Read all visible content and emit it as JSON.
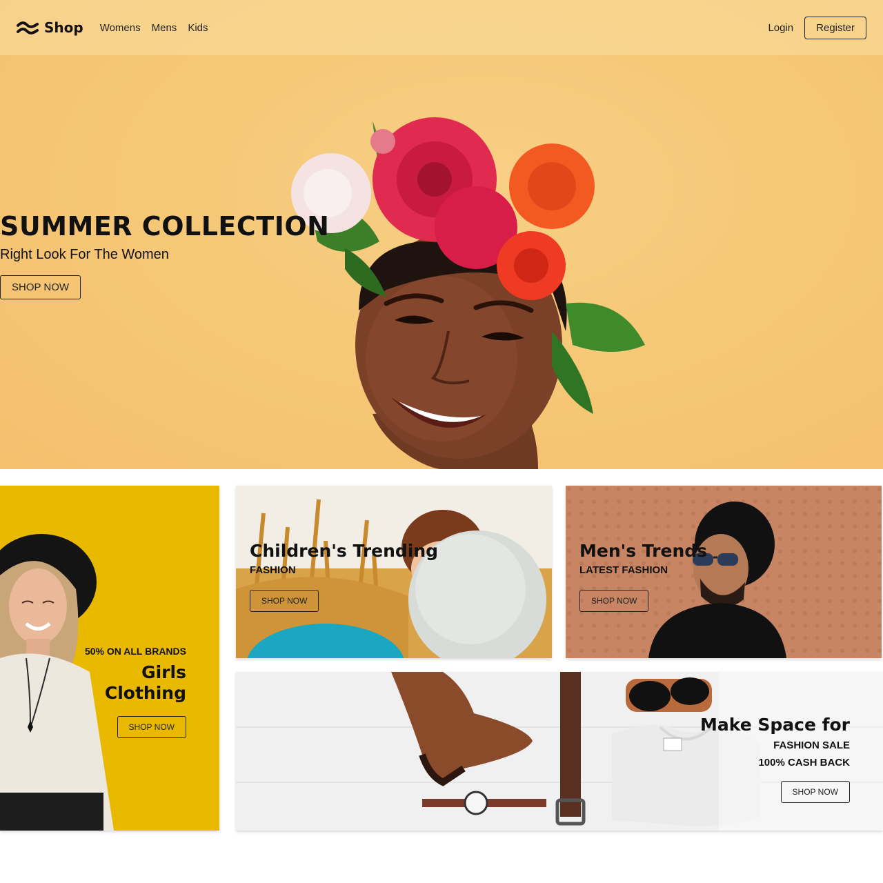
{
  "nav": {
    "brand": "Shop",
    "links": [
      "Womens",
      "Mens",
      "Kids"
    ],
    "login": "Login",
    "register": "Register"
  },
  "hero": {
    "title": "SUMMER COLLECTION",
    "subtitle": "Right Look For The Women",
    "cta": "SHOP NOW"
  },
  "cards": {
    "girls": {
      "kicker": "50% ON ALL BRANDS",
      "heading_line1": "Girls",
      "heading_line2": "Clothing",
      "cta": "SHOP NOW"
    },
    "kids": {
      "heading": "Children's Trending",
      "kicker": "FASHION",
      "cta": "SHOP NOW"
    },
    "men": {
      "heading": "Men's Trends",
      "kicker": "LATEST FASHION",
      "cta": "SHOP NOW"
    },
    "fashion": {
      "heading": "Make Space for",
      "kicker1": "FASHION SALE",
      "kicker2": "100% CASH BACK",
      "cta": "SHOP NOW"
    }
  },
  "colors": {
    "hero_bg": "#f6c877",
    "girls_bg": "#e9b900",
    "men_bg": "#c27e5a",
    "kids_bg": "#d9a34a",
    "fashion_bg": "#f1f1f1"
  },
  "icons": {
    "logo": "wave-logo-icon"
  }
}
